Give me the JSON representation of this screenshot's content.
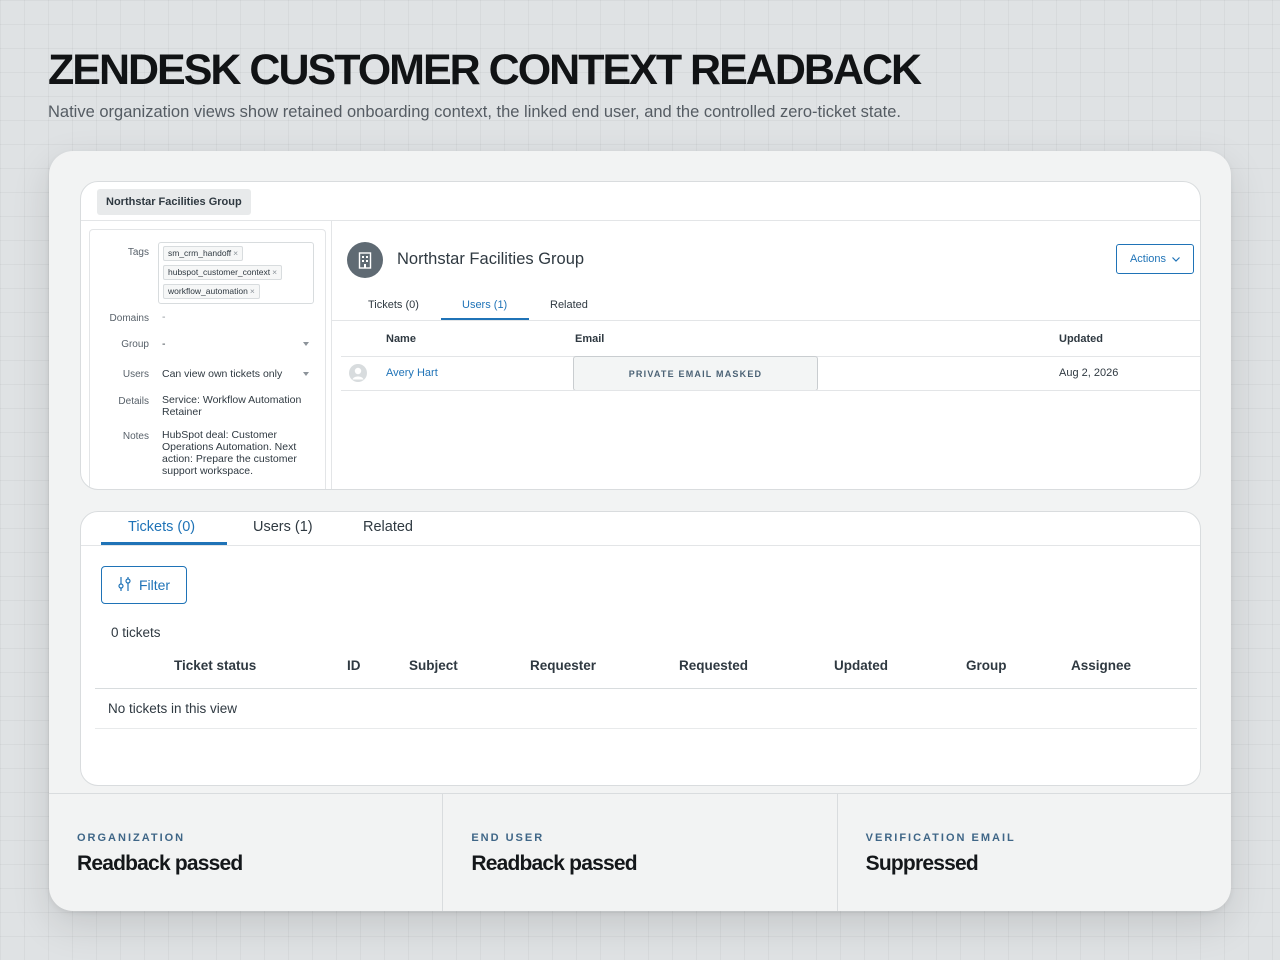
{
  "page": {
    "title": "ZENDESK CUSTOMER CONTEXT READBACK",
    "subtitle": "Native organization views show retained onboarding context, the linked end user, and the controlled zero-ticket state."
  },
  "org_panel": {
    "tab_label": "Northstar Facilities Group",
    "properties": {
      "tags_label": "Tags",
      "tags": [
        "sm_crm_handoff",
        "hubspot_customer_context",
        "workflow_automation"
      ],
      "domains_label": "Domains",
      "domains_value": "-",
      "group_label": "Group",
      "group_value": "-",
      "users_label": "Users",
      "users_value": "Can view own tickets only",
      "details_label": "Details",
      "details_value": "Service: Workflow Automation Retainer",
      "notes_label": "Notes",
      "notes_value": "HubSpot deal: Customer Operations Automation. Next action: Prepare the customer support workspace."
    },
    "org_name": "Northstar Facilities Group",
    "actions_label": "Actions",
    "tabs": [
      {
        "label": "Tickets (0)"
      },
      {
        "label": "Users (1)"
      },
      {
        "label": "Related"
      }
    ],
    "active_tab": "Users (1)",
    "users_table": {
      "columns": {
        "name": "Name",
        "email": "Email",
        "updated": "Updated"
      },
      "rows": [
        {
          "name": "Avery Hart",
          "email": "PRIVATE EMAIL MASKED",
          "updated": "Aug 2, 2026"
        }
      ]
    }
  },
  "tickets_panel": {
    "tabs": [
      {
        "label": "Tickets (0)"
      },
      {
        "label": "Users (1)"
      },
      {
        "label": "Related"
      }
    ],
    "active_tab": "Tickets (0)",
    "filter_label": "Filter",
    "count_text": "0 tickets",
    "columns": [
      "Ticket status",
      "ID",
      "Subject",
      "Requester",
      "Requested",
      "Updated",
      "Group",
      "Assignee"
    ],
    "empty_text": "No tickets in this view"
  },
  "status": [
    {
      "label": "ORGANIZATION",
      "value": "Readback passed"
    },
    {
      "label": "END USER",
      "value": "Readback passed"
    },
    {
      "label": "VERIFICATION EMAIL",
      "value": "Suppressed"
    }
  ],
  "colors": {
    "accent": "#1f73b7",
    "status_label": "#3f6687",
    "background": "#dfe2e4"
  }
}
